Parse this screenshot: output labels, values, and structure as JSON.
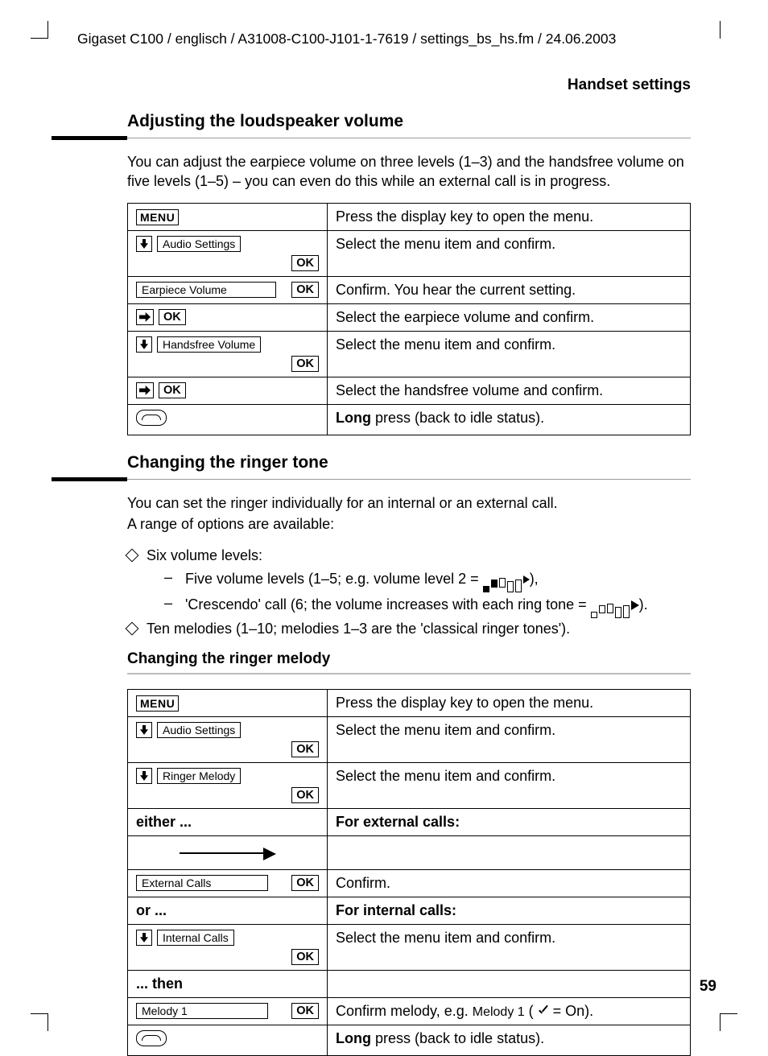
{
  "header": {
    "path": "Gigaset C100 / englisch / A31008-C100-J101-1-7619 / settings_bs_hs.fm / 24.06.2003",
    "section": "Handset settings"
  },
  "keys": {
    "menu": "MENU",
    "ok": "OK",
    "audioSettings": "Audio Settings",
    "earpieceVolume": "Earpiece Volume",
    "handsfreeVolume": "Handsfree Volume",
    "ringerMelody": "Ringer Melody",
    "externalCalls": "External Calls",
    "internalCalls": "Internal Calls",
    "melody1": "Melody 1"
  },
  "sections": {
    "volume": {
      "title": "Adjusting the loudspeaker volume",
      "intro": "You can adjust the earpiece volume on three levels (1–3) and the handsfree volume on five levels (1–5) – you can even do this while an external call is in progress.",
      "steps": [
        {
          "desc": "Press the display key to open the menu."
        },
        {
          "desc": "Select the menu item and confirm."
        },
        {
          "desc": "Confirm. You hear the current setting."
        },
        {
          "desc": "Select the earpiece volume and confirm."
        },
        {
          "desc": "Select the menu item and confirm."
        },
        {
          "desc": "Select the handsfree volume and confirm."
        },
        {
          "bold": "Long",
          "rest": "press (back to idle status)."
        }
      ]
    },
    "ringer": {
      "title": "Changing the ringer tone",
      "intro1": "You can set the ringer individually for an internal or an external call.",
      "intro2": "A range of options are available:",
      "bullets": [
        "Six volume levels:",
        "Ten melodies (1–10; melodies 1–3 are the 'classical ringer tones')."
      ],
      "sub": [
        {
          "pre": "Five volume levels (1–5; e.g. volume level 2 = ",
          "post": "),"
        },
        {
          "pre": "'Crescendo' call (6; the volume increases with each ring tone = ",
          "post": ")."
        }
      ]
    },
    "melody": {
      "title": "Changing the ringer melody",
      "either": "either ...",
      "forExternal": "For external calls:",
      "or": "or ...",
      "forInternal": "For internal calls:",
      "then": "... then",
      "steps": [
        {
          "desc": "Press the display key to open the menu."
        },
        {
          "desc": "Select the menu item and confirm."
        },
        {
          "desc": "Select the menu item and confirm."
        },
        {
          "desc": "Confirm."
        },
        {
          "desc": "Select the menu item and confirm."
        },
        {
          "pre": "Confirm melody, e.g. ",
          "mel": "Melody 1",
          "mid": " ( ",
          "post": " = On)."
        },
        {
          "bold": "Long",
          "rest": "press (back to idle status)."
        }
      ]
    }
  },
  "footer": {
    "page": "59"
  }
}
